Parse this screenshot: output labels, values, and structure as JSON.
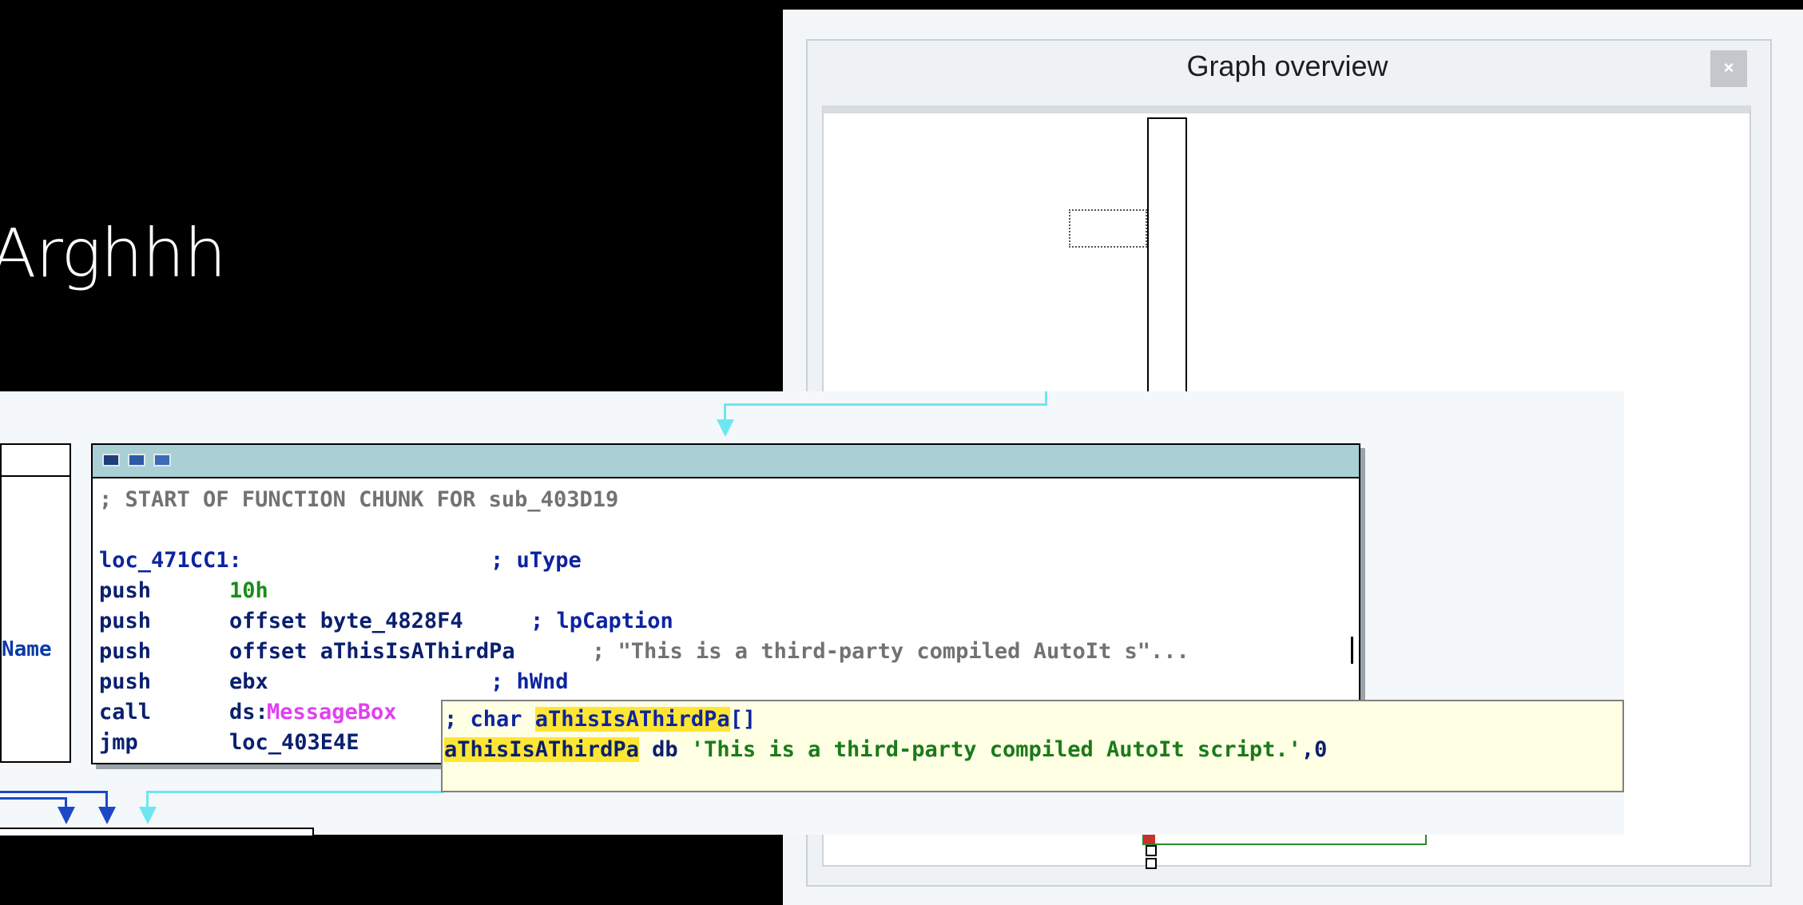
{
  "slide": {
    "title": "Arghhh"
  },
  "graph_overview": {
    "title": "Graph overview",
    "close_label": "×"
  },
  "left_node": {
    "fragment": "Name"
  },
  "main_node": {
    "header_icons": [
      "color-icon",
      "graph-icon",
      "text-icon"
    ],
    "comment_line": "; START OF FUNCTION CHUNK FOR sub_403D19",
    "label": "loc_471CC1:",
    "label_comment": "; uType",
    "rows": [
      {
        "mnemonic": "push",
        "op_part1": "10h",
        "op_part2": "",
        "comment": ""
      },
      {
        "mnemonic": "push",
        "op_part1": "offset byte_4828F4",
        "op_part2": "",
        "comment": "; lpCaption"
      },
      {
        "mnemonic": "push",
        "op_part1": "offset aThisIsAThirdPa",
        "op_part2": "",
        "comment": "; \"This is a third-party compiled AutoIt s\"..."
      },
      {
        "mnemonic": "push",
        "op_part1": "ebx",
        "op_part2": "",
        "comment": "; hWnd"
      },
      {
        "mnemonic": "call",
        "op_part1": "ds:",
        "op_part2": "MessageBox",
        "comment": ""
      },
      {
        "mnemonic": "jmp",
        "op_part1": "loc_403E4E",
        "op_part2": "",
        "comment": ""
      }
    ]
  },
  "tooltip": {
    "line1_prefix": "; char ",
    "line1_name": "aThisIsAThirdPa",
    "line1_suffix": "[]",
    "line2_name": "aThisIsAThirdPa",
    "line2_mid": " db ",
    "line2_string": "'This is a third-party compiled AutoIt script.'",
    "line2_tail": ",0"
  },
  "colors": {
    "header": "#a9d0d4",
    "tooltip_bg": "#ffffe3",
    "highlight": "#ffe633",
    "edge_cyan": "#6ee6f2",
    "edge_blue": "#1c48c8"
  }
}
